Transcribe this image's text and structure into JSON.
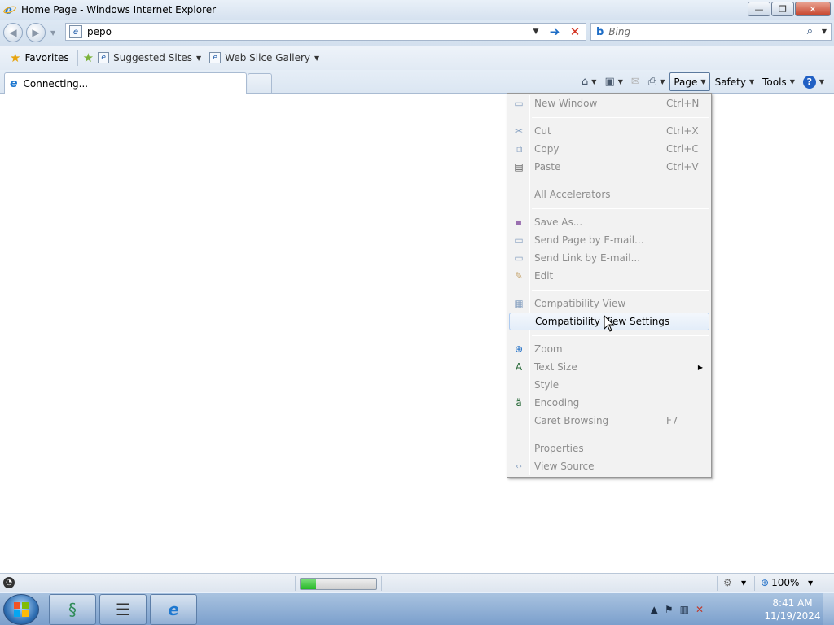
{
  "window": {
    "title": "Home Page - Windows Internet Explorer",
    "min_glyph": "—",
    "max_glyph": "❐",
    "close_glyph": "✕"
  },
  "address": {
    "url": "pepo",
    "search_placeholder": "Bing"
  },
  "favorites": {
    "favorites_label": "Favorites",
    "suggested_sites": "Suggested Sites",
    "web_slice_gallery": "Web Slice Gallery"
  },
  "tab": {
    "label": "Connecting..."
  },
  "commandbar": {
    "page": "Page",
    "safety": "Safety",
    "tools": "Tools"
  },
  "page_menu": {
    "items": [
      {
        "label": "New Window",
        "shortcut": "Ctrl+N",
        "icon": "new-window-icon",
        "enabled": false
      },
      {
        "label": "Cut",
        "shortcut": "Ctrl+X",
        "icon": "cut-icon",
        "enabled": false
      },
      {
        "label": "Copy",
        "shortcut": "Ctrl+C",
        "icon": "copy-icon",
        "enabled": false
      },
      {
        "label": "Paste",
        "shortcut": "Ctrl+V",
        "icon": "paste-icon",
        "enabled": false
      },
      {
        "label": "All Accelerators",
        "shortcut": "",
        "icon": "",
        "enabled": false
      },
      {
        "label": "Save As...",
        "shortcut": "",
        "icon": "save-icon",
        "enabled": false
      },
      {
        "label": "Send Page by E-mail...",
        "shortcut": "",
        "icon": "send-page-icon",
        "enabled": false
      },
      {
        "label": "Send Link by E-mail...",
        "shortcut": "",
        "icon": "send-link-icon",
        "enabled": false
      },
      {
        "label": "Edit",
        "shortcut": "",
        "icon": "edit-icon",
        "enabled": false
      },
      {
        "label": "Compatibility View",
        "shortcut": "",
        "icon": "compatibility-view-icon",
        "enabled": false
      },
      {
        "label": "Compatibility View Settings",
        "shortcut": "",
        "icon": "",
        "enabled": true
      },
      {
        "label": "Zoom",
        "shortcut": "",
        "icon": "zoom-icon",
        "enabled": false
      },
      {
        "label": "Text Size",
        "shortcut": "",
        "icon": "text-size-icon",
        "enabled": false
      },
      {
        "label": "Style",
        "shortcut": "",
        "icon": "",
        "enabled": false
      },
      {
        "label": "Encoding",
        "shortcut": "",
        "icon": "encoding-icon",
        "enabled": false
      },
      {
        "label": "Caret Browsing",
        "shortcut": "F7",
        "icon": "",
        "enabled": false
      },
      {
        "label": "Properties",
        "shortcut": "",
        "icon": "",
        "enabled": false
      },
      {
        "label": "View Source",
        "shortcut": "",
        "icon": "view-source-icon",
        "enabled": false
      }
    ]
  },
  "status": {
    "progress_fraction": 0.2,
    "zoom": "100%"
  },
  "taskbar": {
    "time": "8:41 AM",
    "date": "11/19/2024"
  },
  "colors": {
    "menu_highlight_border": "#aecbf0",
    "disabled_text": "#8d8d8d",
    "progress_fill": "#25b825"
  }
}
